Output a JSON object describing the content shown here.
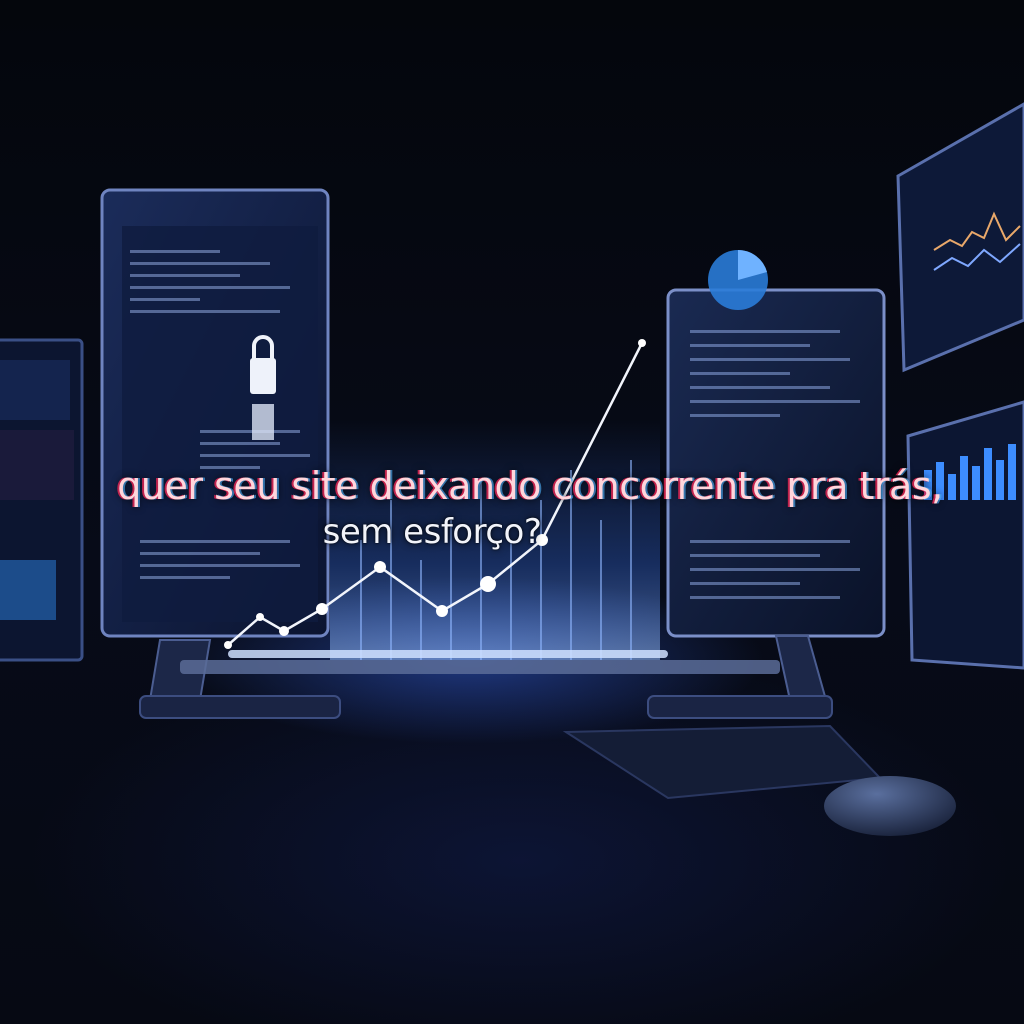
{
  "headline": {
    "line1": "quer seu site deixando concorrente pra trás,",
    "line2": "sem esforço?"
  },
  "colors": {
    "background": "#05070d",
    "accent_blue": "#3d7bff",
    "glow": "#9cc4ff",
    "text": "#f2f4fa",
    "glitch_red": "#ff2a5a"
  },
  "icons": [
    "padlock-icon",
    "pie-chart-icon",
    "growth-line-chart-icon",
    "bar-chart-icon",
    "computer-mouse-icon",
    "keyboard-icon"
  ]
}
